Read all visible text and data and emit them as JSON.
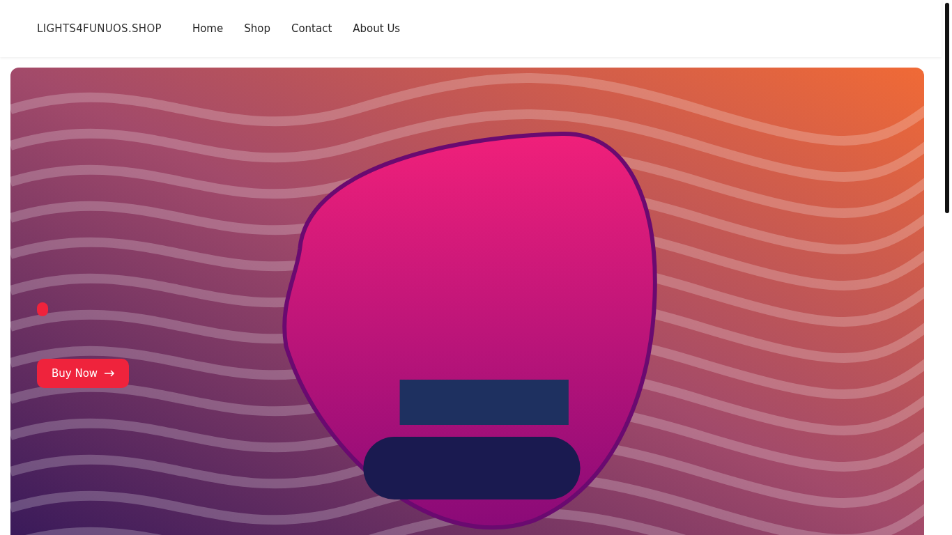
{
  "header": {
    "brand": "LIGHTS4FUNUOS.SHOP",
    "nav": [
      {
        "label": "Home"
      },
      {
        "label": "Shop"
      },
      {
        "label": "Contact"
      },
      {
        "label": "About Us"
      }
    ]
  },
  "hero": {
    "button": {
      "label": "Buy Now"
    }
  }
}
